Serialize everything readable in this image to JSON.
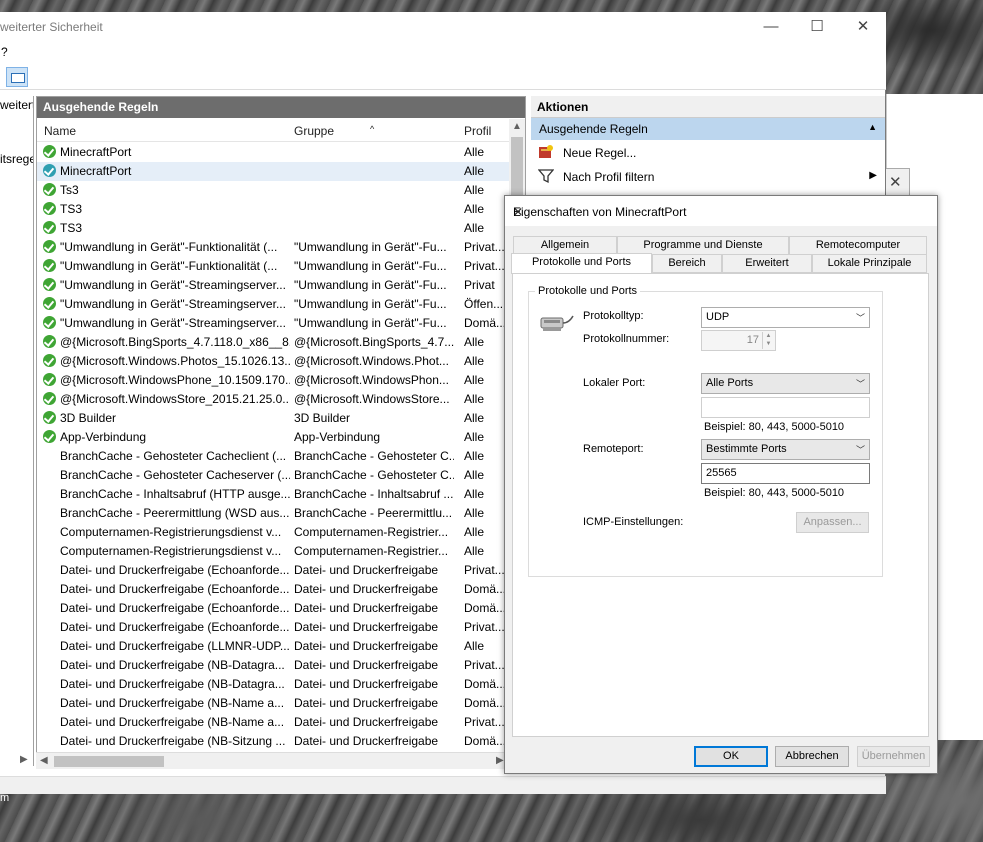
{
  "main_window": {
    "title": "weiterter Sicherheit",
    "menu_label": "?",
    "left_pane": {
      "items": [
        "weitert",
        "itsrege"
      ]
    },
    "center": {
      "header": "Ausgehende Regeln",
      "columns": {
        "name": "Name",
        "group": "Gruppe",
        "profile": "Profil"
      },
      "rows": [
        {
          "name": "MinecraftPort",
          "group": "",
          "profile": "Alle"
        },
        {
          "name": "MinecraftPort",
          "group": "",
          "profile": "Alle"
        },
        {
          "name": "Ts3",
          "group": "",
          "profile": "Alle"
        },
        {
          "name": "TS3",
          "group": "",
          "profile": "Alle"
        },
        {
          "name": "TS3",
          "group": "",
          "profile": "Alle"
        },
        {
          "name": "\"Umwandlung in Gerät\"-Funktionalität (...",
          "group": "\"Umwandlung in Gerät\"-Fu...",
          "profile": "Privat..."
        },
        {
          "name": "\"Umwandlung in Gerät\"-Funktionalität (...",
          "group": "\"Umwandlung in Gerät\"-Fu...",
          "profile": "Privat..."
        },
        {
          "name": "\"Umwandlung in Gerät\"-Streamingserver...",
          "group": "\"Umwandlung in Gerät\"-Fu...",
          "profile": "Privat"
        },
        {
          "name": "\"Umwandlung in Gerät\"-Streamingserver...",
          "group": "\"Umwandlung in Gerät\"-Fu...",
          "profile": "Öffen..."
        },
        {
          "name": "\"Umwandlung in Gerät\"-Streamingserver...",
          "group": "\"Umwandlung in Gerät\"-Fu...",
          "profile": "Domä..."
        },
        {
          "name": "@{Microsoft.BingSports_4.7.118.0_x86__8...",
          "group": "@{Microsoft.BingSports_4.7....",
          "profile": "Alle"
        },
        {
          "name": "@{Microsoft.Windows.Photos_15.1026.13...",
          "group": "@{Microsoft.Windows.Phot...",
          "profile": "Alle"
        },
        {
          "name": "@{Microsoft.WindowsPhone_10.1509.170...",
          "group": "@{Microsoft.WindowsPhon...",
          "profile": "Alle"
        },
        {
          "name": "@{Microsoft.WindowsStore_2015.21.25.0...",
          "group": "@{Microsoft.WindowsStore...",
          "profile": "Alle"
        },
        {
          "name": "3D Builder",
          "group": "3D Builder",
          "profile": "Alle"
        },
        {
          "name": "App-Verbindung",
          "group": "App-Verbindung",
          "profile": "Alle"
        },
        {
          "name": "BranchCache - Gehosteter Cacheclient (...",
          "group": "BranchCache - Gehosteter C...",
          "profile": "Alle"
        },
        {
          "name": "BranchCache - Gehosteter Cacheserver (...",
          "group": "BranchCache - Gehosteter C...",
          "profile": "Alle"
        },
        {
          "name": "BranchCache - Inhaltsabruf (HTTP ausge...",
          "group": "BranchCache - Inhaltsabruf ...",
          "profile": "Alle"
        },
        {
          "name": "BranchCache - Peerermittlung (WSD aus...",
          "group": "BranchCache - Peerermittlu...",
          "profile": "Alle"
        },
        {
          "name": "Computernamen-Registrierungsdienst v...",
          "group": "Computernamen-Registrier...",
          "profile": "Alle"
        },
        {
          "name": "Computernamen-Registrierungsdienst v...",
          "group": "Computernamen-Registrier...",
          "profile": "Alle"
        },
        {
          "name": "Datei- und Druckerfreigabe (Echoanforde...",
          "group": "Datei- und Druckerfreigabe",
          "profile": "Privat..."
        },
        {
          "name": "Datei- und Druckerfreigabe (Echoanforde...",
          "group": "Datei- und Druckerfreigabe",
          "profile": "Domä..."
        },
        {
          "name": "Datei- und Druckerfreigabe (Echoanforde...",
          "group": "Datei- und Druckerfreigabe",
          "profile": "Domä..."
        },
        {
          "name": "Datei- und Druckerfreigabe (Echoanforde...",
          "group": "Datei- und Druckerfreigabe",
          "profile": "Privat..."
        },
        {
          "name": "Datei- und Druckerfreigabe (LLMNR-UDP...",
          "group": "Datei- und Druckerfreigabe",
          "profile": "Alle"
        },
        {
          "name": "Datei- und Druckerfreigabe (NB-Datagra...",
          "group": "Datei- und Druckerfreigabe",
          "profile": "Privat..."
        },
        {
          "name": "Datei- und Druckerfreigabe (NB-Datagra...",
          "group": "Datei- und Druckerfreigabe",
          "profile": "Domä..."
        },
        {
          "name": "Datei- und Druckerfreigabe (NB-Name a...",
          "group": "Datei- und Druckerfreigabe",
          "profile": "Domä..."
        },
        {
          "name": "Datei- und Druckerfreigabe (NB-Name a...",
          "group": "Datei- und Druckerfreigabe",
          "profile": "Privat..."
        },
        {
          "name": "Datei- und Druckerfreigabe (NB-Sitzung ...",
          "group": "Datei- und Druckerfreigabe",
          "profile": "Domä..."
        }
      ]
    },
    "actions": {
      "header": "Aktionen",
      "section": "Ausgehende Regeln",
      "items": [
        "Neue Regel...",
        "Nach Profil filtern"
      ]
    },
    "footer_text": "m"
  },
  "dialog": {
    "title": "Eigenschaften von MinecraftPort",
    "tabs_row1": [
      "Allgemein",
      "Programme und Dienste",
      "Remotecomputer"
    ],
    "tabs_row2": [
      "Protokolle und Ports",
      "Bereich",
      "Erweitert",
      "Lokale Prinzipale"
    ],
    "group_title": "Protokolle und Ports",
    "protocol_type_label": "Protokolltyp:",
    "protocol_type_value": "UDP",
    "protocol_number_label": "Protokollnummer:",
    "protocol_number_value": "17",
    "local_port_label": "Lokaler Port:",
    "local_port_value": "Alle Ports",
    "local_port_text": "",
    "example_1": "Beispiel: 80, 443, 5000-5010",
    "remote_port_label": "Remoteport:",
    "remote_port_value": "Bestimmte Ports",
    "remote_port_text": "25565",
    "example_2": "Beispiel: 80, 443, 5000-5010",
    "icmp_label": "ICMP-Einstellungen:",
    "icmp_button": "Anpassen...",
    "ok": "OK",
    "cancel": "Abbrechen",
    "apply": "Übernehmen"
  },
  "colors": {
    "accent": "#0078d7",
    "header_bg": "#6d6d6d",
    "selection": "#bcd6ee",
    "check_green": "#3fa534"
  }
}
